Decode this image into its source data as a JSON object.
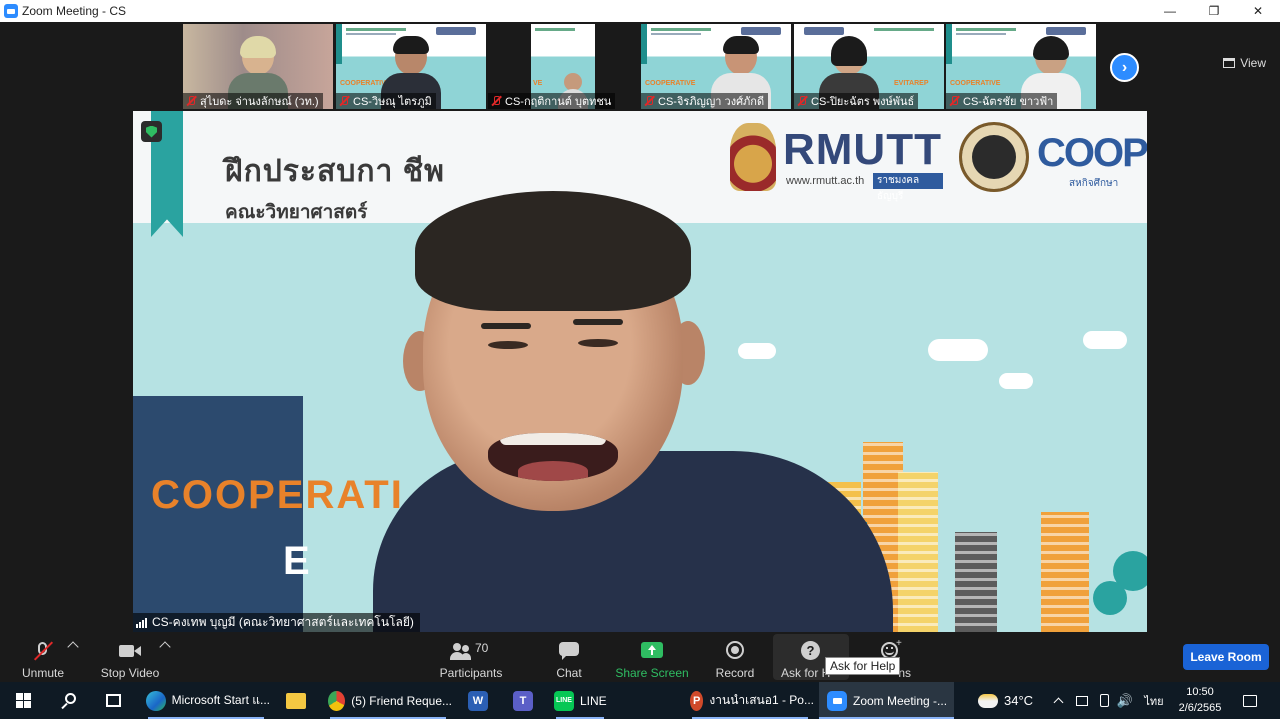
{
  "window": {
    "title": "Zoom Meeting - CS",
    "controls": [
      "minimize-icon",
      "restore-icon",
      "close-icon"
    ]
  },
  "gallery": {
    "participants": [
      {
        "name": "สุไบดะ จ่านงลักษณ์ (วท.)",
        "muted": true
      },
      {
        "name": "CS-วิษณุ ไตรภูมิ",
        "muted": true
      },
      {
        "name": "CS-กฤติกานต์ บุตทชน",
        "muted": true
      },
      {
        "name": "CS-จิรภิญญา วงศ์ภักดี",
        "muted": true
      },
      {
        "name": "CS-ปิยะฉัตร พงษ์พันธ์",
        "muted": true
      },
      {
        "name": "CS-ฉัตรชัย ขาวฟ้า",
        "muted": true
      }
    ],
    "view_label": "View"
  },
  "main_video": {
    "speaker_name": "CS-คงเทพ บุญมี (คณะวิทยาศาสตร์และเทคโนโลยี)",
    "slide": {
      "title": "ฝึกประสบกา         ชีพ",
      "subtitle": "คณะวิทยาศาสตร์",
      "logo_main": "RMUTT",
      "logo_url": "www.rmutt.ac.th",
      "logo_tag": "ราชมงคลธัญบุรี",
      "logo_coop": "COOP",
      "logo_coop_sub": "สหกิจศึกษา",
      "coop_text": "COOPERATI",
      "coop_text2": "E"
    }
  },
  "toolbar": {
    "unmute": "Unmute",
    "stop_video": "Stop Video",
    "participants_count": "70",
    "participants": "Participants",
    "chat": "Chat",
    "share_screen": "Share Screen",
    "record": "Record",
    "ask_for_help": "Ask for H",
    "reactions": "ns",
    "tooltip": "Ask for Help",
    "leave": "Leave Room"
  },
  "taskbar": {
    "items": [
      {
        "label": "Microsoft Start แ...",
        "icon": "edge-icon"
      },
      {
        "label": "(5) Friend Reque...",
        "icon": "chrome-icon"
      },
      {
        "label": "LINE",
        "icon": "line-icon"
      },
      {
        "label": "งานนำเสนอ1 - Po...",
        "icon": "powerpoint-icon"
      },
      {
        "label": "Zoom Meeting -...",
        "icon": "zoom-icon"
      }
    ],
    "weather": "34°C",
    "lang": "ไทย",
    "time": "10:50",
    "date": "2/6/2565"
  },
  "colors": {
    "zoom_blue": "#2d8cff",
    "leave_blue": "#1a63d6",
    "share_green": "#2fbd62",
    "muted_red": "#e02828"
  }
}
